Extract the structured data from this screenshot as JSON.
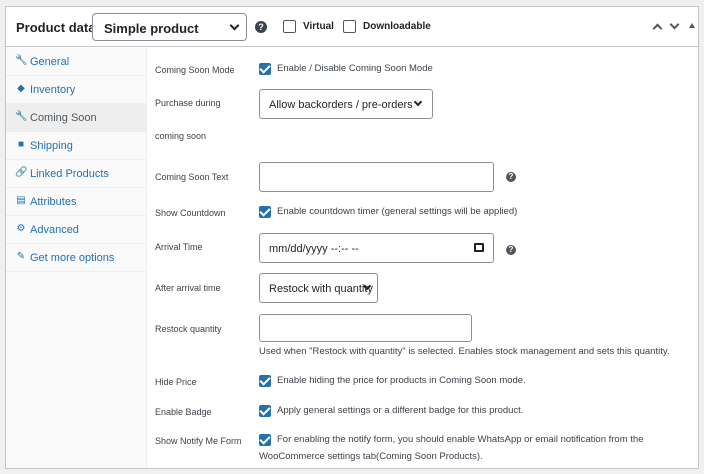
{
  "header": {
    "title": "Product data —",
    "product_type": "Simple product",
    "virtual_label": "Virtual",
    "downloadable_label": "Downloadable",
    "help_glyph": "?"
  },
  "sidebar": {
    "items": [
      {
        "label": "General",
        "icon": "wrench-icon",
        "glyph": "🔧"
      },
      {
        "label": "Inventory",
        "icon": "tag-icon",
        "glyph": "◆"
      },
      {
        "label": "Coming Soon",
        "icon": "wrench-icon",
        "glyph": "🔧",
        "active": true
      },
      {
        "label": "Shipping",
        "icon": "truck-icon",
        "glyph": "■"
      },
      {
        "label": "Linked Products",
        "icon": "link-icon",
        "glyph": "🔗"
      },
      {
        "label": "Attributes",
        "icon": "list-icon",
        "glyph": "▤"
      },
      {
        "label": "Advanced",
        "icon": "gear-icon",
        "glyph": "⚙"
      },
      {
        "label": "Get more options",
        "icon": "plugin-icon",
        "glyph": "✎"
      }
    ]
  },
  "fields": {
    "coming_soon_mode": {
      "label": "Coming Soon Mode",
      "checkbox_text": "Enable / Disable Coming Soon Mode",
      "checked": true
    },
    "purchase_during": {
      "label_line1": "Purchase during",
      "label_line2": "coming soon",
      "value": "Allow backorders / pre-orders"
    },
    "coming_soon_text": {
      "label": "Coming Soon Text",
      "value": ""
    },
    "show_countdown": {
      "label": "Show Countdown",
      "checkbox_text": "Enable countdown timer (general settings will be applied)",
      "checked": true
    },
    "arrival_time": {
      "label": "Arrival Time",
      "value": "mm/dd/yyyy --:-- --"
    },
    "after_arrival": {
      "label": "After arrival time",
      "value": "Restock with quantity"
    },
    "restock_quantity": {
      "label": "Restock quantity",
      "value": "",
      "description": "Used when \"Restock with quantity\" is selected. Enables stock management and sets this quantity."
    },
    "hide_price": {
      "label": "Hide Price",
      "checkbox_text": "Enable hiding the price for products in Coming Soon mode.",
      "checked": true
    },
    "enable_badge": {
      "label": "Enable Badge",
      "checkbox_text": "Apply general settings or a different badge for this product.",
      "checked": true
    },
    "notify_form": {
      "label": "Show Notify Me Form",
      "checkbox_text_line1": "For enabling the notify form, you should enable WhatsApp or email notification from the",
      "checkbox_text_line2": "WooCommerce settings tab(Coming Soon Products).",
      "checked": true
    }
  },
  "colors": {
    "accent": "#2271b1",
    "border": "#c3c4c7",
    "text": "#3c434a"
  }
}
